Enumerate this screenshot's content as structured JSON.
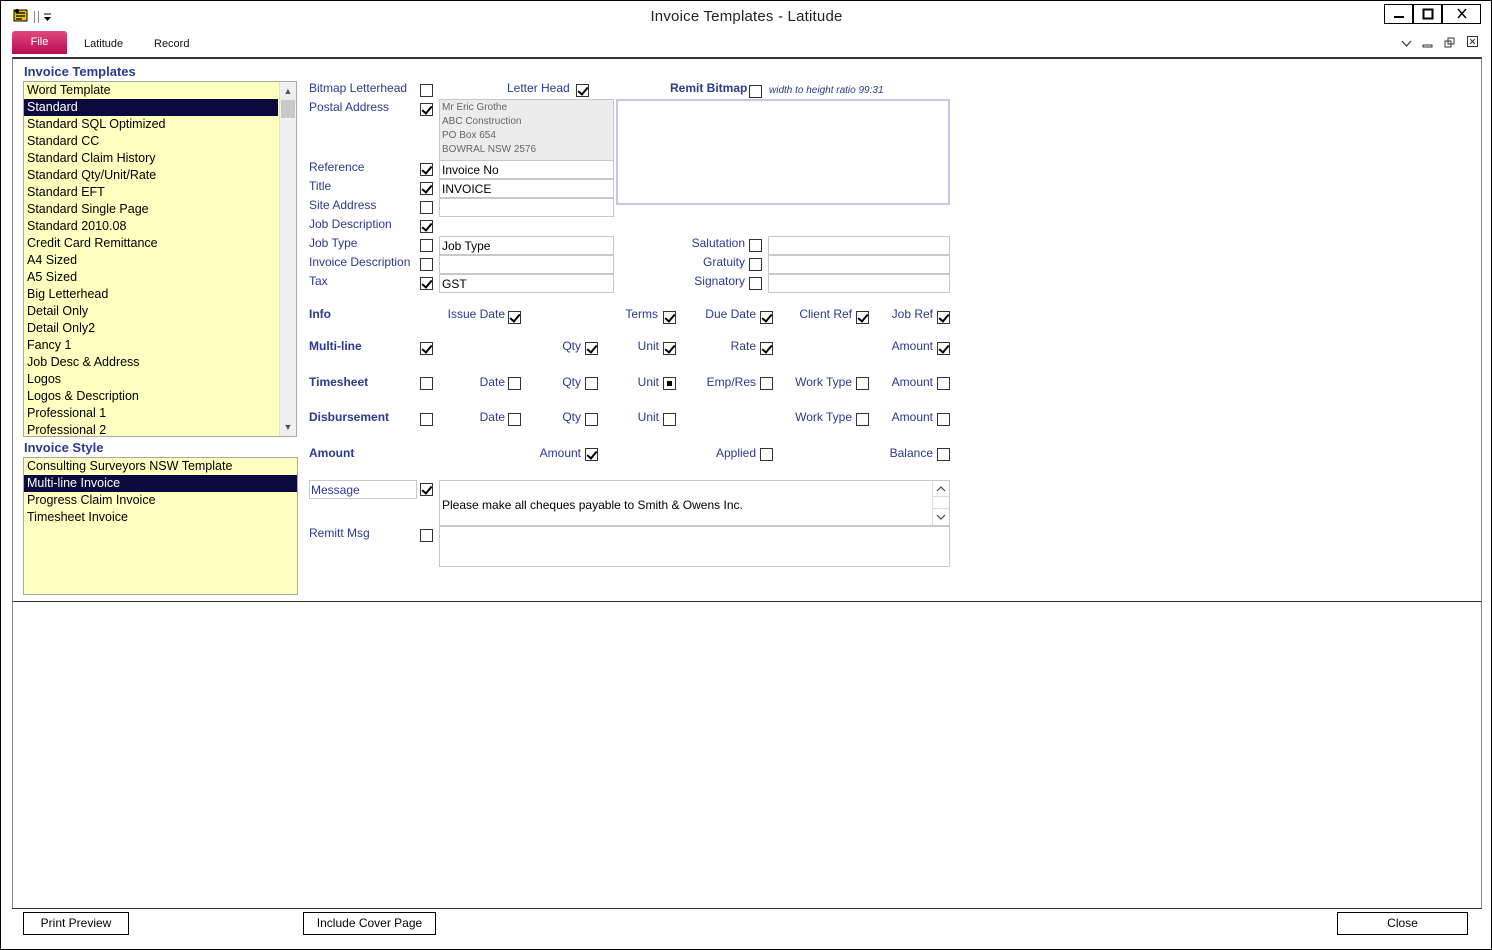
{
  "window": {
    "title": "Invoice Templates - Latitude"
  },
  "menubar": {
    "file": "File",
    "latitude": "Latitude",
    "record": "Record"
  },
  "templates": {
    "heading": "Invoice Templates",
    "items": [
      "Word Template",
      "Standard",
      "Standard SQL Optimized",
      "Standard CC",
      "Standard Claim History",
      "Standard Qty/Unit/Rate",
      "Standard EFT",
      "Standard Single Page",
      "Standard 2010.08",
      "Credit Card Remittance",
      "A4 Sized",
      "A5 Sized",
      "Big Letterhead",
      "Detail Only",
      "Detail Only2",
      "Fancy 1",
      "Job Desc & Address",
      "Logos",
      "Logos & Description",
      "Professional 1",
      "Professional 2"
    ],
    "selected": "Standard"
  },
  "styles": {
    "heading": "Invoice Style",
    "items": [
      "Consulting Surveyors NSW Template",
      "Multi-line Invoice",
      "Progress Claim Invoice",
      "Timesheet Invoice"
    ],
    "selected": "Multi-line Invoice"
  },
  "header": {
    "bitmap_letterhead": "Bitmap Letterhead",
    "letter_head": "Letter Head",
    "remit_bitmap": "Remit Bitmap",
    "ratio_note": "width to height ratio 99:31"
  },
  "fields": {
    "postal_address": "Postal Address",
    "address_lines": [
      "Mr Eric Grothe",
      "ABC Construction",
      "PO Box 654",
      "BOWRAL  NSW  2576"
    ],
    "reference": "Reference",
    "reference_value": "Invoice No",
    "title": "Title",
    "title_value": "INVOICE",
    "site_address": "Site Address",
    "job_description": "Job Description",
    "job_type": "Job Type",
    "job_type_value": "Job Type",
    "invoice_description": "Invoice Description",
    "tax": "Tax",
    "tax_value": "GST",
    "salutation": "Salutation",
    "gratuity": "Gratuity",
    "signatory": "Signatory"
  },
  "info": {
    "label": "Info",
    "issue_date": "Issue Date",
    "terms": "Terms",
    "due_date": "Due Date",
    "client_ref": "Client Ref",
    "job_ref": "Job Ref"
  },
  "multiline": {
    "label": "Multi-line",
    "qty": "Qty",
    "unit": "Unit",
    "rate": "Rate",
    "amount": "Amount"
  },
  "timesheet": {
    "label": "Timesheet",
    "date": "Date",
    "qty": "Qty",
    "unit": "Unit",
    "emp_res": "Emp/Res",
    "work_type": "Work Type",
    "amount": "Amount"
  },
  "disbursement": {
    "label": "Disbursement",
    "date": "Date",
    "qty": "Qty",
    "unit": "Unit",
    "work_type": "Work Type",
    "amount": "Amount"
  },
  "amount": {
    "label": "Amount",
    "amount": "Amount",
    "applied": "Applied",
    "balance": "Balance"
  },
  "message": {
    "label": "Message",
    "text": "Please make all cheques payable to Smith & Owens Inc.",
    "remitt_label": "Remitt Msg"
  },
  "footer": {
    "print_preview": "Print Preview",
    "include_cover": "Include Cover Page",
    "close": "Close"
  }
}
